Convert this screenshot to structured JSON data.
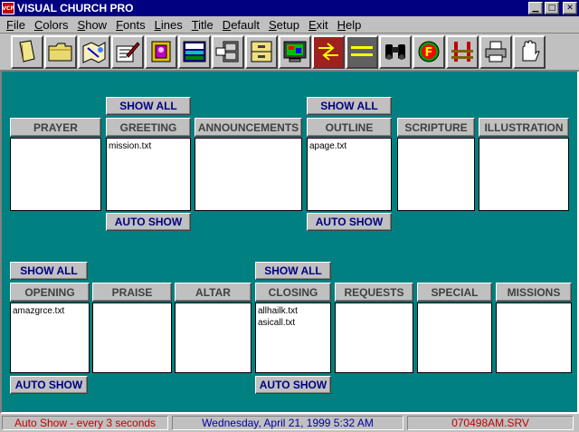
{
  "window": {
    "icon_text": "VCP",
    "title": "VISUAL CHURCH PRO",
    "minimize": "▁",
    "maximize": "□",
    "close": "✕"
  },
  "menu": [
    {
      "label": "File",
      "accel": "F",
      "rest": "ile"
    },
    {
      "label": "Colors",
      "accel": "C",
      "rest": "olors"
    },
    {
      "label": "Show",
      "accel": "S",
      "rest": "how"
    },
    {
      "label": "Fonts",
      "accel": "F",
      "rest": "onts"
    },
    {
      "label": "Lines",
      "accel": "L",
      "rest": "ines"
    },
    {
      "label": "Title",
      "accel": "T",
      "rest": "itle"
    },
    {
      "label": "Default",
      "accel": "D",
      "rest": "efault"
    },
    {
      "label": "Setup",
      "accel": "S",
      "rest": "etup"
    },
    {
      "label": "Exit",
      "accel": "E",
      "rest": "xit"
    },
    {
      "label": "Help",
      "accel": "H",
      "rest": "elp"
    }
  ],
  "toolbar": {
    "icons": [
      "open-file-icon",
      "folder-icon",
      "map-icon",
      "edit-pencil-icon",
      "picture-frame-icon",
      "display-screen-icon",
      "file-cabinet-icon",
      "drawer-icon",
      "monitor-icon",
      "arrows-icon",
      "lines-icon",
      "binoculars-icon",
      "font-icon",
      "gate-icon",
      "printer-icon",
      "stop-hand-icon"
    ]
  },
  "panels": {
    "prayer": {
      "title": "PRAYER",
      "files": []
    },
    "greeting": {
      "title": "GREETING",
      "show_all": "SHOW ALL",
      "auto_show": "AUTO SHOW",
      "files": [
        "mission.txt"
      ]
    },
    "announcements": {
      "title": "ANNOUNCEMENTS",
      "files": []
    },
    "outline": {
      "title": "OUTLINE",
      "show_all": "SHOW ALL",
      "auto_show": "AUTO SHOW",
      "files": [
        "apage.txt"
      ]
    },
    "scripture": {
      "title": "SCRIPTURE",
      "files": []
    },
    "illustration": {
      "title": "ILLUSTRATION",
      "files": []
    },
    "opening": {
      "title": "OPENING",
      "show_all": "SHOW ALL",
      "auto_show": "AUTO SHOW",
      "files": [
        "amazgrce.txt"
      ]
    },
    "praise": {
      "title": "PRAISE",
      "files": []
    },
    "altar": {
      "title": "ALTAR",
      "files": []
    },
    "closing": {
      "title": "CLOSING",
      "show_all": "SHOW ALL",
      "auto_show": "AUTO SHOW",
      "files": [
        "allhailk.txt",
        "asicall.txt"
      ]
    },
    "requests": {
      "title": "REQUESTS",
      "files": []
    },
    "special": {
      "title": "SPECIAL",
      "files": []
    },
    "missions": {
      "title": "MISSIONS",
      "files": []
    }
  },
  "status": {
    "auto_show": "Auto Show - every 3 seconds",
    "datetime": "Wednesday, April 21, 1999   5:32 AM",
    "file": "070498AM.SRV"
  },
  "colors": {
    "desktop_teal": "#008080",
    "title_navy": "#000080",
    "status_red": "#c00000",
    "status_blue": "#0000a0"
  }
}
